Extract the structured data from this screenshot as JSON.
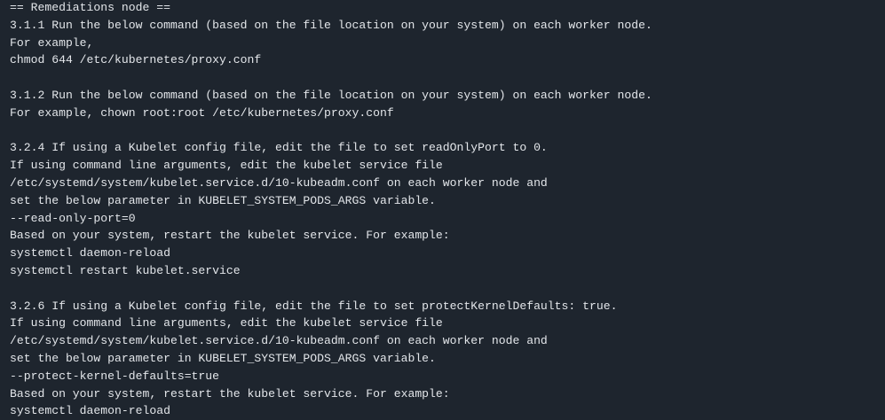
{
  "terminal": {
    "background": "#1e252e",
    "text_color": "#e3e6ea",
    "lines": [
      "== Remediations node ==",
      "3.1.1 Run the below command (based on the file location on your system) on each worker node.",
      "For example,",
      "chmod 644 /etc/kubernetes/proxy.conf",
      "",
      "3.1.2 Run the below command (based on the file location on your system) on each worker node.",
      "For example, chown root:root /etc/kubernetes/proxy.conf",
      "",
      "3.2.4 If using a Kubelet config file, edit the file to set readOnlyPort to 0.",
      "If using command line arguments, edit the kubelet service file",
      "/etc/systemd/system/kubelet.service.d/10-kubeadm.conf on each worker node and",
      "set the below parameter in KUBELET_SYSTEM_PODS_ARGS variable.",
      "--read-only-port=0",
      "Based on your system, restart the kubelet service. For example:",
      "systemctl daemon-reload",
      "systemctl restart kubelet.service",
      "",
      "3.2.6 If using a Kubelet config file, edit the file to set protectKernelDefaults: true.",
      "If using command line arguments, edit the kubelet service file",
      "/etc/systemd/system/kubelet.service.d/10-kubeadm.conf on each worker node and",
      "set the below parameter in KUBELET_SYSTEM_PODS_ARGS variable.",
      "--protect-kernel-defaults=true",
      "Based on your system, restart the kubelet service. For example:",
      "systemctl daemon-reload"
    ]
  }
}
